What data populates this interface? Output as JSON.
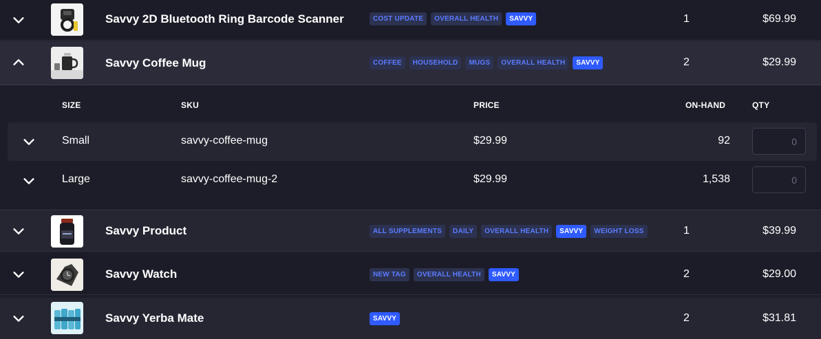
{
  "products": [
    {
      "name": "Savvy 2D Bluetooth Ring Barcode Scanner",
      "thumb_icon": "ring-scanner-image",
      "tags": [
        {
          "label": "COST UPDATE",
          "style": "outline"
        },
        {
          "label": "OVERALL HEALTH",
          "style": "outline"
        },
        {
          "label": "SAVVY",
          "style": "solid"
        }
      ],
      "variant_count": "1",
      "price": "$69.99",
      "chevron": "chevron-down-icon"
    },
    {
      "name": "Savvy Coffee Mug",
      "thumb_icon": "coffee-mug-image",
      "tags": [
        {
          "label": "COFFEE",
          "style": "outline"
        },
        {
          "label": "HOUSEHOLD",
          "style": "outline"
        },
        {
          "label": "MUGS",
          "style": "outline"
        },
        {
          "label": "OVERALL HEALTH",
          "style": "outline"
        },
        {
          "label": "SAVVY",
          "style": "solid"
        }
      ],
      "variant_count": "2",
      "price": "$29.99",
      "chevron": "chevron-up-icon"
    },
    {
      "name": "Savvy Product",
      "thumb_icon": "supplement-bottle-image",
      "tags": [
        {
          "label": "ALL SUPPLEMENTS",
          "style": "outline"
        },
        {
          "label": "DAILY",
          "style": "outline"
        },
        {
          "label": "OVERALL HEALTH",
          "style": "outline"
        },
        {
          "label": "SAVVY",
          "style": "solid"
        },
        {
          "label": "WEIGHT LOSS",
          "style": "outline"
        }
      ],
      "variant_count": "1",
      "price": "$39.99",
      "chevron": "chevron-down-icon"
    },
    {
      "name": "Savvy Watch",
      "thumb_icon": "watch-image",
      "tags": [
        {
          "label": "NEW TAG",
          "style": "outline"
        },
        {
          "label": "OVERALL HEALTH",
          "style": "outline"
        },
        {
          "label": "SAVVY",
          "style": "solid"
        }
      ],
      "variant_count": "2",
      "price": "$29.00",
      "chevron": "chevron-down-icon"
    },
    {
      "name": "Savvy Yerba Mate",
      "thumb_icon": "yerba-mate-cans-image",
      "tags": [
        {
          "label": "SAVVY",
          "style": "solid"
        }
      ],
      "variant_count": "2",
      "price": "$31.81",
      "chevron": "chevron-down-icon"
    }
  ],
  "variants_header": {
    "size": "SIZE",
    "sku": "SKU",
    "price": "PRICE",
    "on_hand": "ON-HAND",
    "qty": "QTY"
  },
  "variants": [
    {
      "size": "Small",
      "sku": "savvy-coffee-mug",
      "price": "$29.99",
      "on_hand": "92",
      "qty_placeholder": "0"
    },
    {
      "size": "Large",
      "sku": "savvy-coffee-mug-2",
      "price": "$29.99",
      "on_hand": "1,538",
      "qty_placeholder": "0"
    }
  ],
  "colors": {
    "tag_outline_bg": "#2c3250",
    "tag_outline_text": "#5c7cff",
    "tag_solid_bg": "#2f5bff"
  }
}
